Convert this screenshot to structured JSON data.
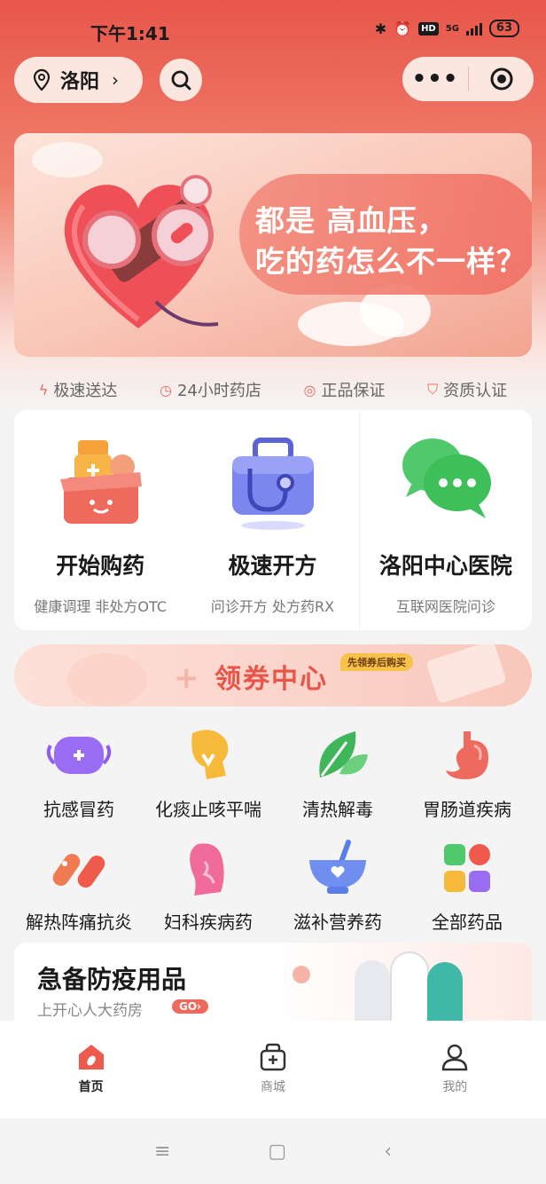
{
  "status_bar": {
    "time": "下午1:41",
    "network": "5G",
    "hd": "HD",
    "battery": "63"
  },
  "header": {
    "location": "洛阳"
  },
  "banner": {
    "line1": "都是 高血压，",
    "line2": "吃的药怎么不一样？"
  },
  "features": [
    {
      "icon": "lightning-icon",
      "label": "极速送达"
    },
    {
      "icon": "clock-24-icon",
      "label": "24小时药店"
    },
    {
      "icon": "genuine-icon",
      "label": "正品保证"
    },
    {
      "icon": "shield-icon",
      "label": "资质认证"
    }
  ],
  "services": [
    {
      "title": "开始购药",
      "subtitle": "健康调理 非处方OTC",
      "icon": "medicine-box-icon"
    },
    {
      "title": "极速开方",
      "subtitle": "问诊开方 处方药RX",
      "icon": "stethoscope-icon"
    },
    {
      "title": "洛阳中心医院",
      "subtitle": "互联网医院问诊",
      "icon": "chat-bubble-icon"
    }
  ],
  "coupon": {
    "title": "领券中心",
    "tag": "先领券后购买"
  },
  "categories": [
    {
      "label": "抗感冒药",
      "icon": "mask-icon"
    },
    {
      "label": "化痰止咳平喘",
      "icon": "throat-icon"
    },
    {
      "label": "清热解毒",
      "icon": "leaf-icon"
    },
    {
      "label": "胃肠道疾病",
      "icon": "stomach-icon"
    },
    {
      "label": "解热阵痛抗炎",
      "icon": "capsule-icon"
    },
    {
      "label": "妇科疾病药",
      "icon": "female-icon"
    },
    {
      "label": "滋补营养药",
      "icon": "bowl-icon"
    },
    {
      "label": "全部药品",
      "icon": "grid-icon"
    }
  ],
  "promo": {
    "title": "急备防疫用品",
    "subtitle": "上开心人大药房",
    "badge": "GO›"
  },
  "tabs": [
    {
      "label": "首页",
      "icon": "home-icon",
      "active": true
    },
    {
      "label": "商城",
      "icon": "shop-icon",
      "active": false
    },
    {
      "label": "我的",
      "icon": "profile-icon",
      "active": false
    }
  ],
  "colors": {
    "brand": "#e8554a",
    "accent": "#f06f62"
  }
}
